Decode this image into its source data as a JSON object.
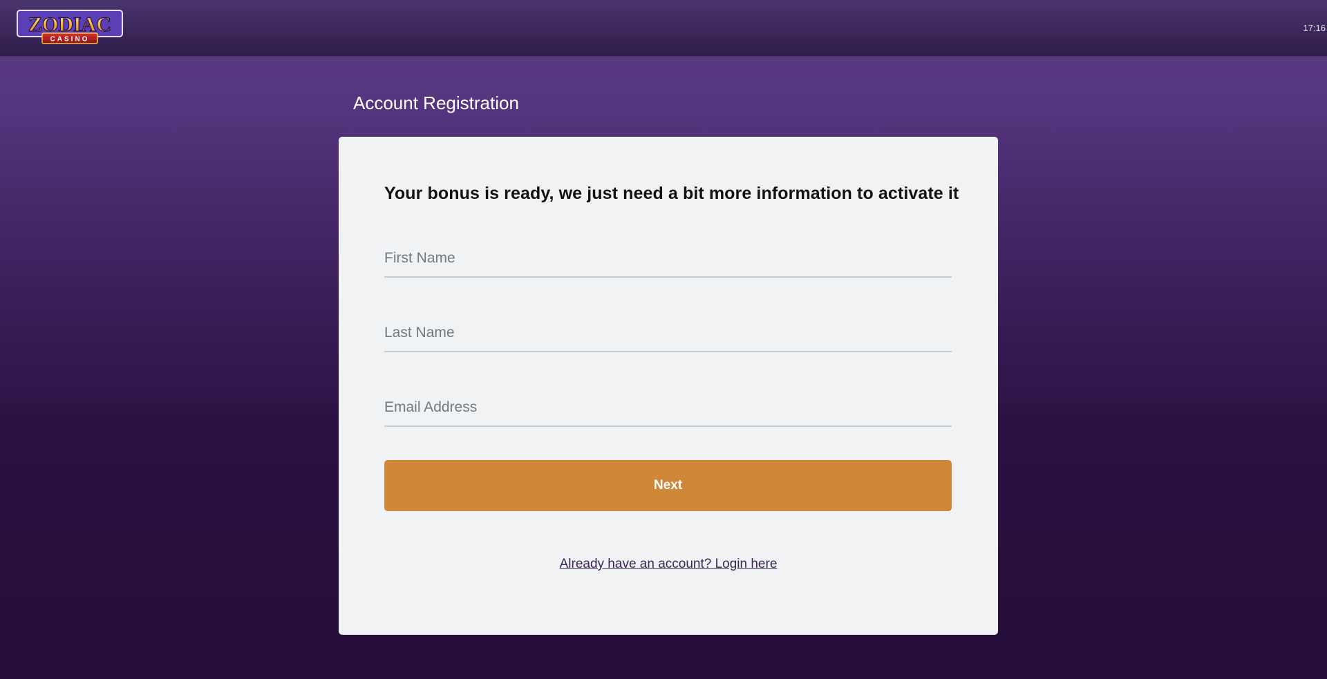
{
  "header": {
    "logo_main": "ZODIAC",
    "logo_sub": "CASINO",
    "time": "17:16"
  },
  "page": {
    "title": "Account Registration"
  },
  "form": {
    "heading": "Your bonus is ready, we just need a bit more information to activate it",
    "first_name_placeholder": "First Name",
    "first_name_value": "",
    "last_name_placeholder": "Last Name",
    "last_name_value": "",
    "email_placeholder": "Email Address",
    "email_value": "",
    "next_label": "Next",
    "login_link": "Already have an account? Login here"
  },
  "colors": {
    "accent": "#cf8838",
    "card_background": "#f0f2f4",
    "link": "#3a2658"
  }
}
